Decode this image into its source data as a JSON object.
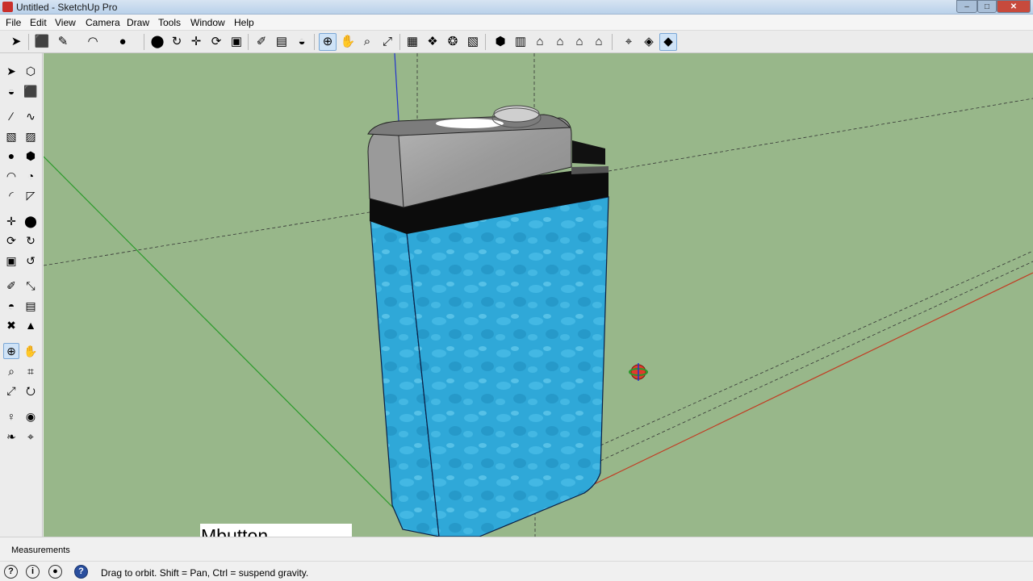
{
  "window": {
    "title": "Untitled - SketchUp Pro",
    "minimize": "–",
    "maximize": "□",
    "close": "✕"
  },
  "menu": [
    "File",
    "Edit",
    "View",
    "Camera",
    "Draw",
    "Tools",
    "Window",
    "Help"
  ],
  "toolbar_icons": [
    "select-icon",
    "eraser-icon",
    "pencil-icon",
    "arc-icon",
    "circle-icon",
    "push-pull-icon",
    "follow-me-icon",
    "move-icon",
    "rotate-icon",
    "scale-icon",
    "tape-measure-icon",
    "text-icon",
    "paint-bucket-icon",
    "orbit-icon",
    "pan-icon",
    "zoom-icon",
    "zoom-extents-icon",
    "3d-warehouse-icon",
    "components-icon",
    "styles-icon",
    "share-model-icon",
    "iso-view-icon",
    "front-view-icon",
    "home-view-icon",
    "top-view-icon",
    "right-view-icon",
    "back-view-icon",
    "section-plane-icon",
    "xray-icon",
    "shaded-icon"
  ],
  "left_tools_icons": [
    "select-icon",
    "component-icon",
    "paint-bucket-icon",
    "eraser-icon",
    "line-icon",
    "freehand-icon",
    "rectangle-icon",
    "rotated-rectangle-icon",
    "circle-icon",
    "polygon-icon",
    "arc-icon",
    "pie-icon",
    "two-point-arc-icon",
    "three-point-arc-icon",
    "move-icon",
    "push-pull-icon",
    "rotate-icon",
    "follow-me-icon",
    "scale-icon",
    "offset-icon",
    "tape-measure-icon",
    "dimension-icon",
    "protractor-icon",
    "text-icon",
    "axes-icon",
    "3d-text-icon",
    "orbit-icon",
    "pan-icon",
    "zoom-icon",
    "zoom-window-icon",
    "zoom-extents-icon",
    "previous-view-icon",
    "position-camera-icon",
    "look-around-icon",
    "walk-icon",
    "section-plane-icon"
  ],
  "key_caption": "Mbutton",
  "measurements": {
    "label": "Measurements",
    "value": ""
  },
  "status": {
    "text": "Drag to orbit. Shift = Pan, Ctrl = suspend gravity."
  },
  "colors": {
    "ground": "#98b78a",
    "x_axis": "#c23b22",
    "y_axis": "#2a9a2a",
    "z_axis": "#2233cc",
    "body": "#2fa8d8",
    "cap": "#a8a8a8"
  }
}
